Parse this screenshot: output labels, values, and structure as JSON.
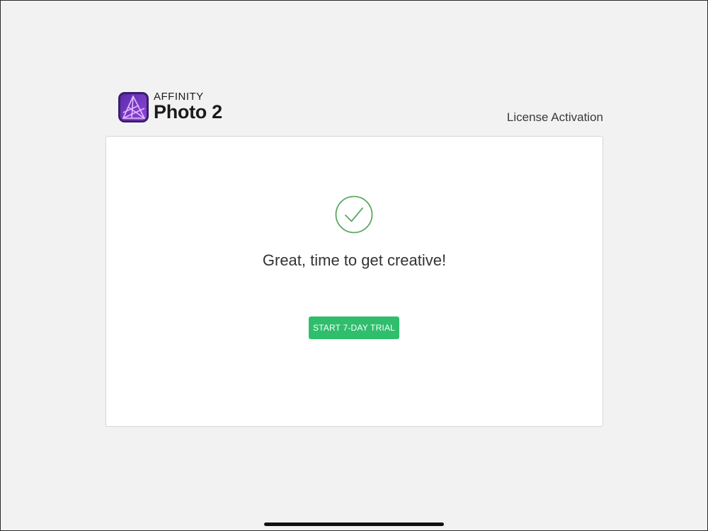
{
  "app": {
    "brand_small": "AFFINITY",
    "brand_large": "Photo 2",
    "logo_icon": "affinity-photo-logo-icon"
  },
  "header": {
    "section_label": "License Activation"
  },
  "card": {
    "status_icon": "checkmark-circle-icon",
    "headline": "Great, time to get creative!",
    "trial_button_label": "START 7-DAY TRIAL"
  },
  "colors": {
    "accent_green": "#2fbe6b",
    "check_green": "#5aa861",
    "logo_purple": "#7e3fd0",
    "background": "#f2f2f2"
  }
}
